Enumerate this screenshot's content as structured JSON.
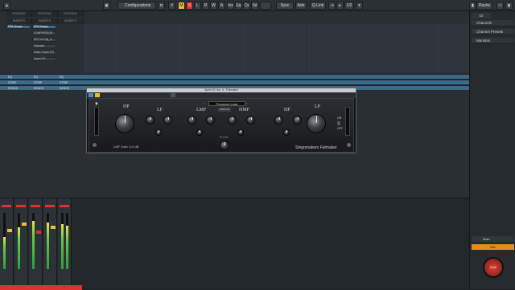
{
  "toolbar": {
    "configurations_label": "Configurations",
    "mode_buttons": [
      "M",
      "S",
      "L",
      "R",
      "W",
      "A"
    ],
    "quick_buttons": [
      "Ins",
      "Eq",
      "Cs",
      "Sd"
    ],
    "sync_label": "Sync",
    "audio_label": "Ado",
    "qlink_label": "Q-Link",
    "quantize_value": "1/2",
    "racks_label": "Racks"
  },
  "tracks": {
    "column_headers": [
      "ROUTING",
      "ROUTING",
      "ROUTING"
    ],
    "inserts_labels": [
      "INSERTS",
      "INSERTS",
      "INSERTS"
    ],
    "send_track": "FPS Groupe",
    "inserts": [
      "FPS Groupe",
      "COMPRESSOR",
      "RVX Vol Clip_m",
      "Fatmaker",
      "Fabric Fusion PG",
      "Saturn FX"
    ],
    "bus_rows": [
      {
        "a": "EQ",
        "b": "EQ",
        "c": "EQ"
      },
      {
        "a": "STRIP",
        "b": "STRIP",
        "c": "STRIP"
      },
      {
        "a": "SENDS",
        "b": "SENDS",
        "c": "SENDS"
      }
    ]
  },
  "plugin": {
    "window_title": "Splint IO: Ins. 4 - Fatmaker",
    "preset_name": "Presence Lead",
    "compare_label": "SWITCH",
    "brand": "Singomakers Fatmaker",
    "lmf_gain": "LMF Gain: 0.0 dB",
    "labels": {
      "hp": "HP",
      "lf": "LF",
      "lmf": "LMF",
      "hmf": "HMF",
      "hf": "HF",
      "lp": "LP",
      "plow": "PLOW"
    },
    "switch_on": "ON",
    "switch_off": "OFF"
  },
  "right_panel": {
    "tab": "Gr",
    "sections": [
      "Channels",
      "Channel Presets",
      "Monitors"
    ],
    "main_label": "Main",
    "main_value": "Mix",
    "knob_value": "0.00"
  },
  "colors": {
    "accent": "#3c6a8a",
    "record": "#e03030",
    "solo": "#e6c031"
  }
}
